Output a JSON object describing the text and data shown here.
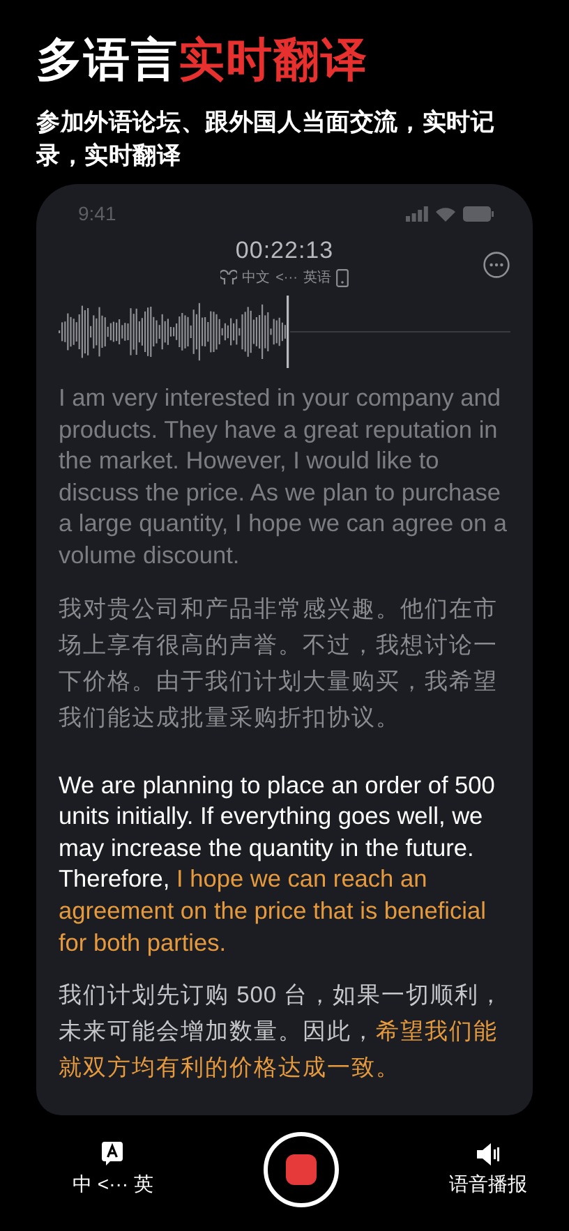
{
  "headline": {
    "plain": "多语言",
    "accent": "实时翻译"
  },
  "subtitle": "参加外语论坛、跟外国人当面交流，实时记录，实时翻译",
  "phone": {
    "status_time": "9:41",
    "timer": "00:22:13",
    "source_lang": "中文",
    "arrow": "<···",
    "target_lang": "英语",
    "transcript": [
      {
        "active": false,
        "english": [
          {
            "text": "I am very interested in your company and products. They have a great reputation in the market. However, I would like to discuss the price. As we plan to purchase a large quantity, I hope we can agree on a volume discount.",
            "highlight": false
          }
        ],
        "chinese": [
          {
            "text": "我对贵公司和产品非常感兴趣。他们在市场上享有很高的声誉。不过，我想讨论一下价格。由于我们计划大量购买，我希望我们能达成批量采购折扣协议。",
            "highlight": false
          }
        ]
      },
      {
        "active": true,
        "english": [
          {
            "text": "We are planning to place an order of 500 units initially. If everything goes well, we may increase the quantity in the future. Therefore, ",
            "highlight": false
          },
          {
            "text": "I hope we can reach an agreement on the price that is beneficial for both parties.",
            "highlight": true
          }
        ],
        "chinese": [
          {
            "text": "我们计划先订购 500 台，如果一切顺利，未来可能会增加数量。因此，",
            "highlight": false
          },
          {
            "text": "希望我们能就双方均有利的价格达成一致。",
            "highlight": true
          }
        ]
      }
    ]
  },
  "bottom_bar": {
    "language_switch": "中 <··· 英",
    "voice_broadcast": "语音播报",
    "recording": true
  }
}
